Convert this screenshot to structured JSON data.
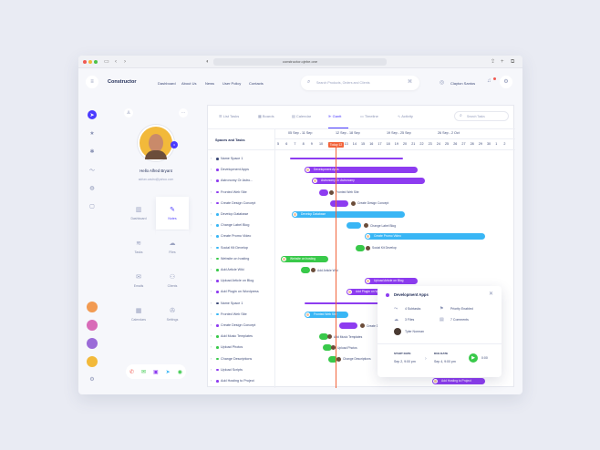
{
  "browser": {
    "url": "constructor.ojebe.one"
  },
  "header": {
    "brand": "Constructor",
    "nav": [
      "Dashboard",
      "About Us",
      "News",
      "User Policy",
      "Contacts"
    ],
    "search_placeholder": "Search Products, Orders and Clients",
    "user_name": "Clayton Santos"
  },
  "profile": {
    "greeting": "Hello Alfred Bryant",
    "email": "adrian.castro@yahoo.com",
    "grid": [
      "Dashboard",
      "Notes",
      "Tasks",
      "Files",
      "Emails",
      "Clients",
      "Calendars",
      "Settings"
    ]
  },
  "gantt": {
    "tabs": [
      "List Tasks",
      "Boards",
      "Calendar",
      "Gantt",
      "Timeline",
      "Activity"
    ],
    "search_placeholder": "Search Tasks",
    "column_header": "Spaces and Tasks",
    "weeks": [
      "05 Sep - 11 Sep",
      "12 Sep - 18 Sep",
      "19 Sep - 25 Sep",
      "26 Sep - 2 Oct"
    ],
    "days": [
      "5",
      "6",
      "7",
      "8",
      "9",
      "10",
      "11",
      "12",
      "13",
      "14",
      "15",
      "16",
      "17",
      "18",
      "19",
      "20",
      "21",
      "22",
      "23",
      "24",
      "25",
      "26",
      "27",
      "28",
      "29",
      "30",
      "1",
      "2"
    ],
    "today": "Today 12",
    "rows": [
      {
        "label": "Name Space 1",
        "bar": ""
      },
      {
        "label": "Development Apps",
        "bar": "Development Apps"
      },
      {
        "label": "Astronomy Or Astro...",
        "bar": "Astronomy Or Astronomy"
      },
      {
        "label": "Fronted Web Site",
        "bar": "Fronted Web Site"
      },
      {
        "label": "Create Design Concept",
        "bar": "Create Design Concept"
      },
      {
        "label": "Develop Database",
        "bar": "Develop Database"
      },
      {
        "label": "Change Label Blog",
        "bar": "Change Label Blog"
      },
      {
        "label": "Create Promo Video",
        "bar": "Create Promo Video"
      },
      {
        "label": "Social Kit Develop",
        "bar": "Social Kit Develop"
      },
      {
        "label": "Website on hosting",
        "bar": "Website on hosting"
      },
      {
        "label": "Add Article Wiki",
        "bar": "Add Article Wiki"
      },
      {
        "label": "Upload Article on Blog",
        "bar": "Upload Article on Blog"
      },
      {
        "label": "Add Plugin on Wordpress",
        "bar": "Add Plugin on Wordpress"
      },
      {
        "label": "Name Space 1",
        "bar": ""
      },
      {
        "label": "Fronted Web Site",
        "bar": "Fronted Web Site"
      },
      {
        "label": "Create Design Concept",
        "bar": "Create Design Concept"
      },
      {
        "label": "Add Music Templates",
        "bar": "Add Music Templates"
      },
      {
        "label": "Upload Photos",
        "bar": "Upload Photos"
      },
      {
        "label": "Change Descriptions",
        "bar": "Change Descriptions"
      },
      {
        "label": "Upload Scripts",
        "bar": ""
      },
      {
        "label": "Add Hosting to Project",
        "bar": "Add Hosting to Project"
      }
    ]
  },
  "popup": {
    "title": "Development Apps",
    "subtasks": "4 Subtasks",
    "priority": "Priority Enabled",
    "files": "3 Files",
    "comments": "7 Comments",
    "assignee": "Tyler Norman",
    "start_label": "START DATE",
    "start_date": "Sep 2, 9:00 pm",
    "due_label": "DUE DATE",
    "due_date": "Sep 4, 9:00 pm",
    "timer": "0:00"
  },
  "colors": {
    "purple": "#8d3cf0",
    "blue": "#39b6f5",
    "green": "#39c94a",
    "today": "#f2643b",
    "text": "#3d4a78"
  }
}
